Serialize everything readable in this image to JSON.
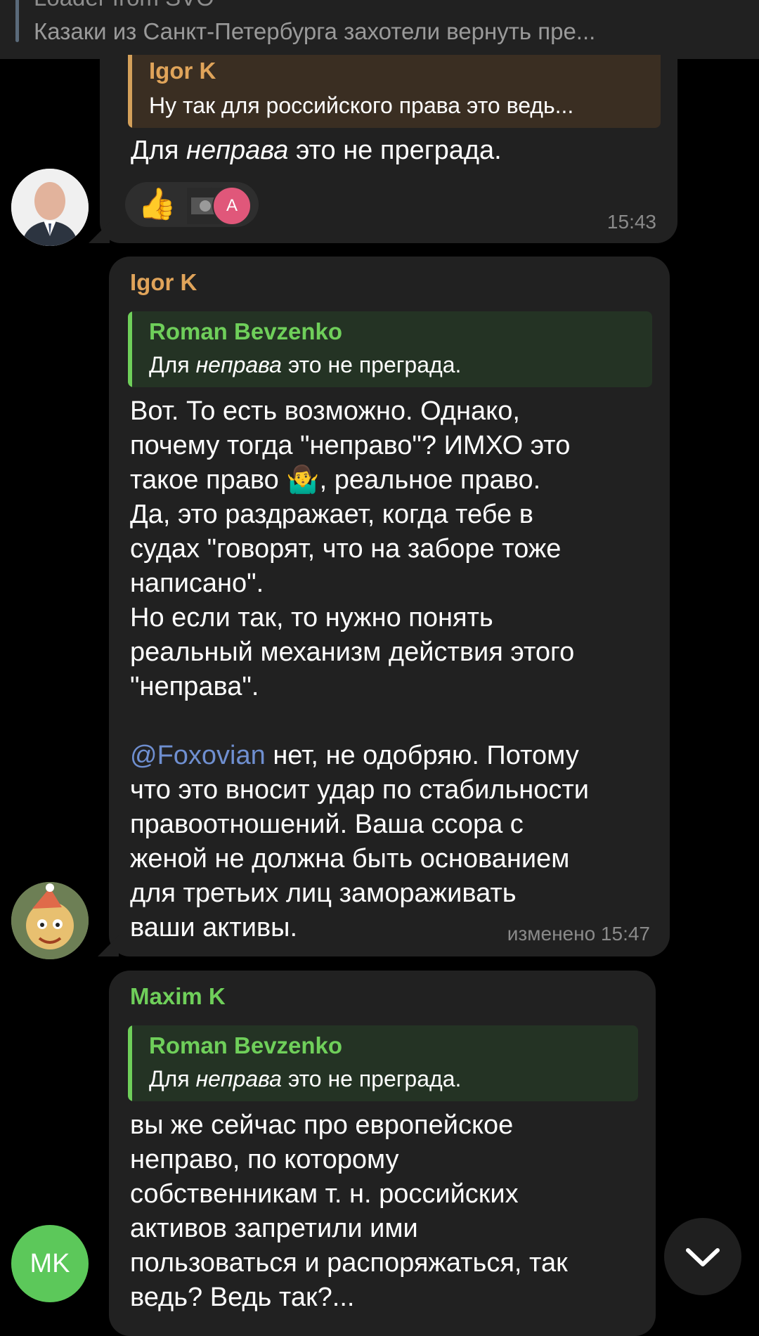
{
  "pinned": {
    "title": "Loader from SVO",
    "text": "Казаки из Санкт-Петербурга захотели вернуть пре..."
  },
  "messages": [
    {
      "reply_name": "Igor K",
      "reply_text": "Ну так для российского права это ведь...",
      "text_before": "Для ",
      "text_em": "неправа",
      "text_after": " это не преграда.",
      "reaction_emoji": "👍",
      "reaction_avatar_letter": "A",
      "time": "15:43",
      "accent": "#d4a05a"
    },
    {
      "sender": "Igor K",
      "reply_name": "Roman Bevzenko",
      "reply_text_before": "Для ",
      "reply_text_em": "неправа",
      "reply_text_after": " это не преграда.",
      "body1": "Вот. То есть возможно. Однако,\nпочему тогда \"неправо\"? ИМХО это\nтакое право",
      "emoji": "🤷‍♂️",
      "body2": ", реальное право.\nДа, это раздражает, когда тебе в\nсудах \"говорят, что на заборе тоже\nнаписано\".\nНо если так, то нужно понять\nреальный механизм действия этого\n\"неправа\".",
      "mention": "@Foxovian",
      "body3": " нет, не одобряю. Потому\nчто это вносит удар по стабильности\nправоотношений. Ваша ссора с\nженой не должна быть основанием\nдля третьих лиц замораживать\nваши активы.",
      "time": "изменено 15:47",
      "sender_color": "#e0a45a"
    },
    {
      "sender": "Maxim K",
      "reply_name": "Roman Bevzenko",
      "reply_text_before": "Для ",
      "reply_text_em": "неправа",
      "reply_text_after": " это не преграда.",
      "body": "вы же сейчас про европейское\nнеправо, по которому\nсобственникам т. н. российских\nактивов запретили ими\nпользоваться и распоряжаться, так\nведь? Ведь так?...",
      "avatar_initials": "MK",
      "sender_color": "#6fcf5a"
    }
  ],
  "colors": {
    "reply_green": "#6fcf5a",
    "reply_green_bg": "#243324",
    "reply_orange_bg": "#3a2e22",
    "avatar_mk": "#5cc85a"
  },
  "icons": {
    "scroll_down": "chevron-down-icon"
  }
}
